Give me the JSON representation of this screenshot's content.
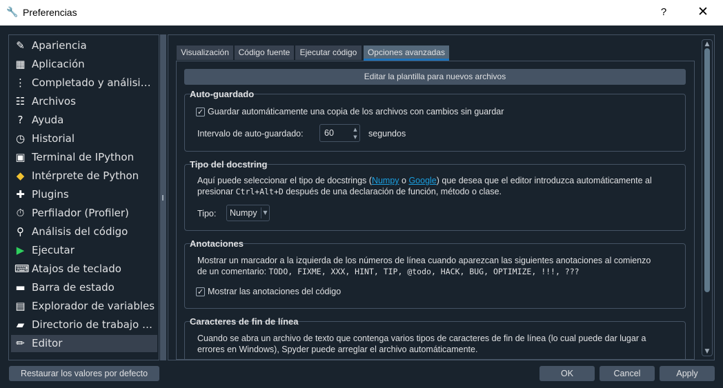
{
  "window": {
    "title": "Preferencias",
    "help": "?",
    "close": "✕"
  },
  "sidebar": {
    "items": [
      {
        "label": "Apariencia",
        "icon": "✎"
      },
      {
        "label": "Aplicación",
        "icon": "▦"
      },
      {
        "label": "Completado y análisis de...",
        "icon": "⋮"
      },
      {
        "label": "Archivos",
        "icon": "☷"
      },
      {
        "label": "Ayuda",
        "icon": "?"
      },
      {
        "label": "Historial",
        "icon": "◷"
      },
      {
        "label": "Terminal de IPython",
        "icon": "▣"
      },
      {
        "label": "Intérprete de Python",
        "icon": "◆"
      },
      {
        "label": "Plugins",
        "icon": "✚"
      },
      {
        "label": "Perfilador (Profiler)",
        "icon": "⏱"
      },
      {
        "label": "Análisis del código",
        "icon": "⚲"
      },
      {
        "label": "Ejecutar",
        "icon": "▶"
      },
      {
        "label": "Atajos de teclado",
        "icon": "⌨"
      },
      {
        "label": "Barra de estado",
        "icon": "▬"
      },
      {
        "label": "Explorador de variables",
        "icon": "▤"
      },
      {
        "label": "Directorio de trabajo act...",
        "icon": "▰"
      },
      {
        "label": "Editor",
        "icon": "✏"
      }
    ],
    "selected_index": 16
  },
  "tabs": [
    "Visualización",
    "Código fuente",
    "Ejecutar código",
    "Opciones avanzadas"
  ],
  "template_button": "Editar la plantilla para nuevos archivos",
  "autosave": {
    "title": "Auto-guardado",
    "checkbox_label": "Guardar automáticamente una copia de los archivos con cambios sin guardar",
    "checked": true,
    "interval_label": "Intervalo de auto-guardado:",
    "interval_value": "60",
    "interval_unit": "segundos"
  },
  "docstring": {
    "title": "Tipo del docstring",
    "desc_1": "Aquí puede seleccionar el tipo de docstrings (",
    "link_numpy": "Numpy",
    "desc_2": " o ",
    "link_google": "Google",
    "desc_3": ") que desea que el editor introduzca automáticamente al",
    "desc_4": "presionar ",
    "shortcut": "Ctrl+Alt+D",
    "desc_5": " después de una declaración de función, método o clase.",
    "type_label": "Tipo:",
    "type_value": "Numpy"
  },
  "annotations": {
    "title": "Anotaciones",
    "desc_1": "Mostrar un marcador a la izquierda de los números de línea cuando aparezcan las siguientes anotaciones al comienzo",
    "desc_2": "de un comentario: ",
    "tags": "TODO, FIXME, XXX, HINT, TIP, @todo, HACK, BUG, OPTIMIZE, !!!, ???",
    "checkbox_label": "Mostrar las anotaciones del código",
    "checked": true
  },
  "eol": {
    "title": "Caracteres de fin de línea",
    "desc_1": "Cuando se abra un archivo de texto que contenga varios tipos de caracteres de fin de línea (lo cual puede dar lugar a",
    "desc_2": "errores en Windows), Spyder puede arreglar el archivo automáticamente."
  },
  "buttons": {
    "restore": "Restaurar los valores por defecto",
    "ok": "OK",
    "cancel": "Cancel",
    "apply": "Apply"
  }
}
